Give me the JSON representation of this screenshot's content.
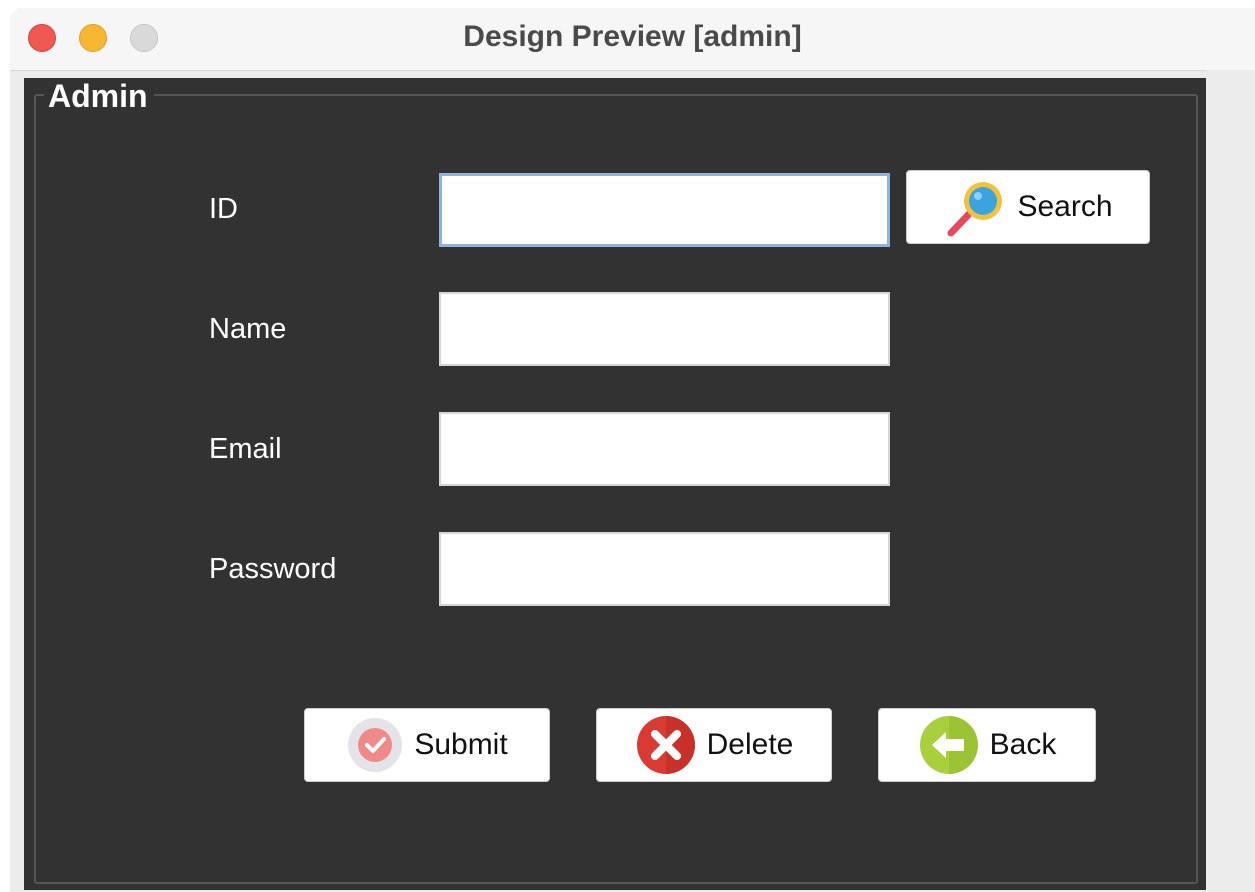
{
  "window": {
    "title": "Design Preview [admin]"
  },
  "group": {
    "legend": "Admin"
  },
  "form": {
    "id_label": "ID",
    "id_value": "",
    "name_label": "Name",
    "name_value": "",
    "email_label": "Email",
    "email_value": "",
    "password_label": "Password",
    "password_value": ""
  },
  "buttons": {
    "search": "Search",
    "submit": "Submit",
    "delete": "Delete",
    "back": "Back"
  },
  "icons": {
    "search": "magnifier-icon",
    "submit": "check-circle-icon",
    "delete": "x-circle-icon",
    "back": "back-arrow-icon"
  },
  "colors": {
    "panel_background": "#323232",
    "close": "#ee5a52",
    "minimize": "#f5b731",
    "maximize": "#d9d9d9",
    "delete_icon": "#d93a32",
    "back_icon": "#a9cf3c",
    "focus_border": "#8fb3dd"
  }
}
